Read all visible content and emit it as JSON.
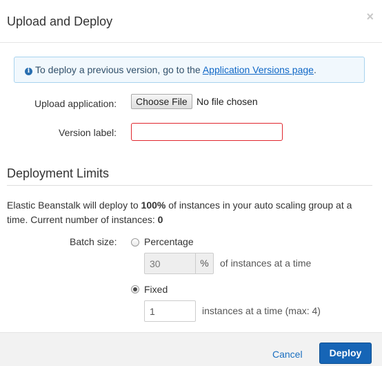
{
  "dialog": {
    "title": "Upload and Deploy",
    "close_symbol": "×"
  },
  "info": {
    "icon": "info-icon",
    "icon_glyph": "i",
    "text": "To deploy a previous version, go to the ",
    "link_text": "Application Versions page",
    "suffix": "."
  },
  "upload": {
    "label": "Upload application:",
    "button_label": "Choose File",
    "status": "No file chosen"
  },
  "version": {
    "label": "Version label:",
    "value": "",
    "error_border_color": "#e0262d"
  },
  "limits": {
    "title": "Deployment Limits",
    "desc_prefix": "Elastic Beanstalk will deploy to ",
    "desc_percent": "100%",
    "desc_middle": " of instances in your auto scaling group at a time. Current number of instances: ",
    "desc_count": "0",
    "batch_label": "Batch size:",
    "percentage": {
      "label": "Percentage",
      "selected": false,
      "value": "30",
      "unit": "%",
      "hint": "of instances at a time"
    },
    "fixed": {
      "label": "Fixed",
      "selected": true,
      "value": "1",
      "hint": "instances at a time (max: 4)"
    }
  },
  "footer": {
    "cancel_label": "Cancel",
    "deploy_label": "Deploy",
    "deploy_color": "#1665b6"
  }
}
